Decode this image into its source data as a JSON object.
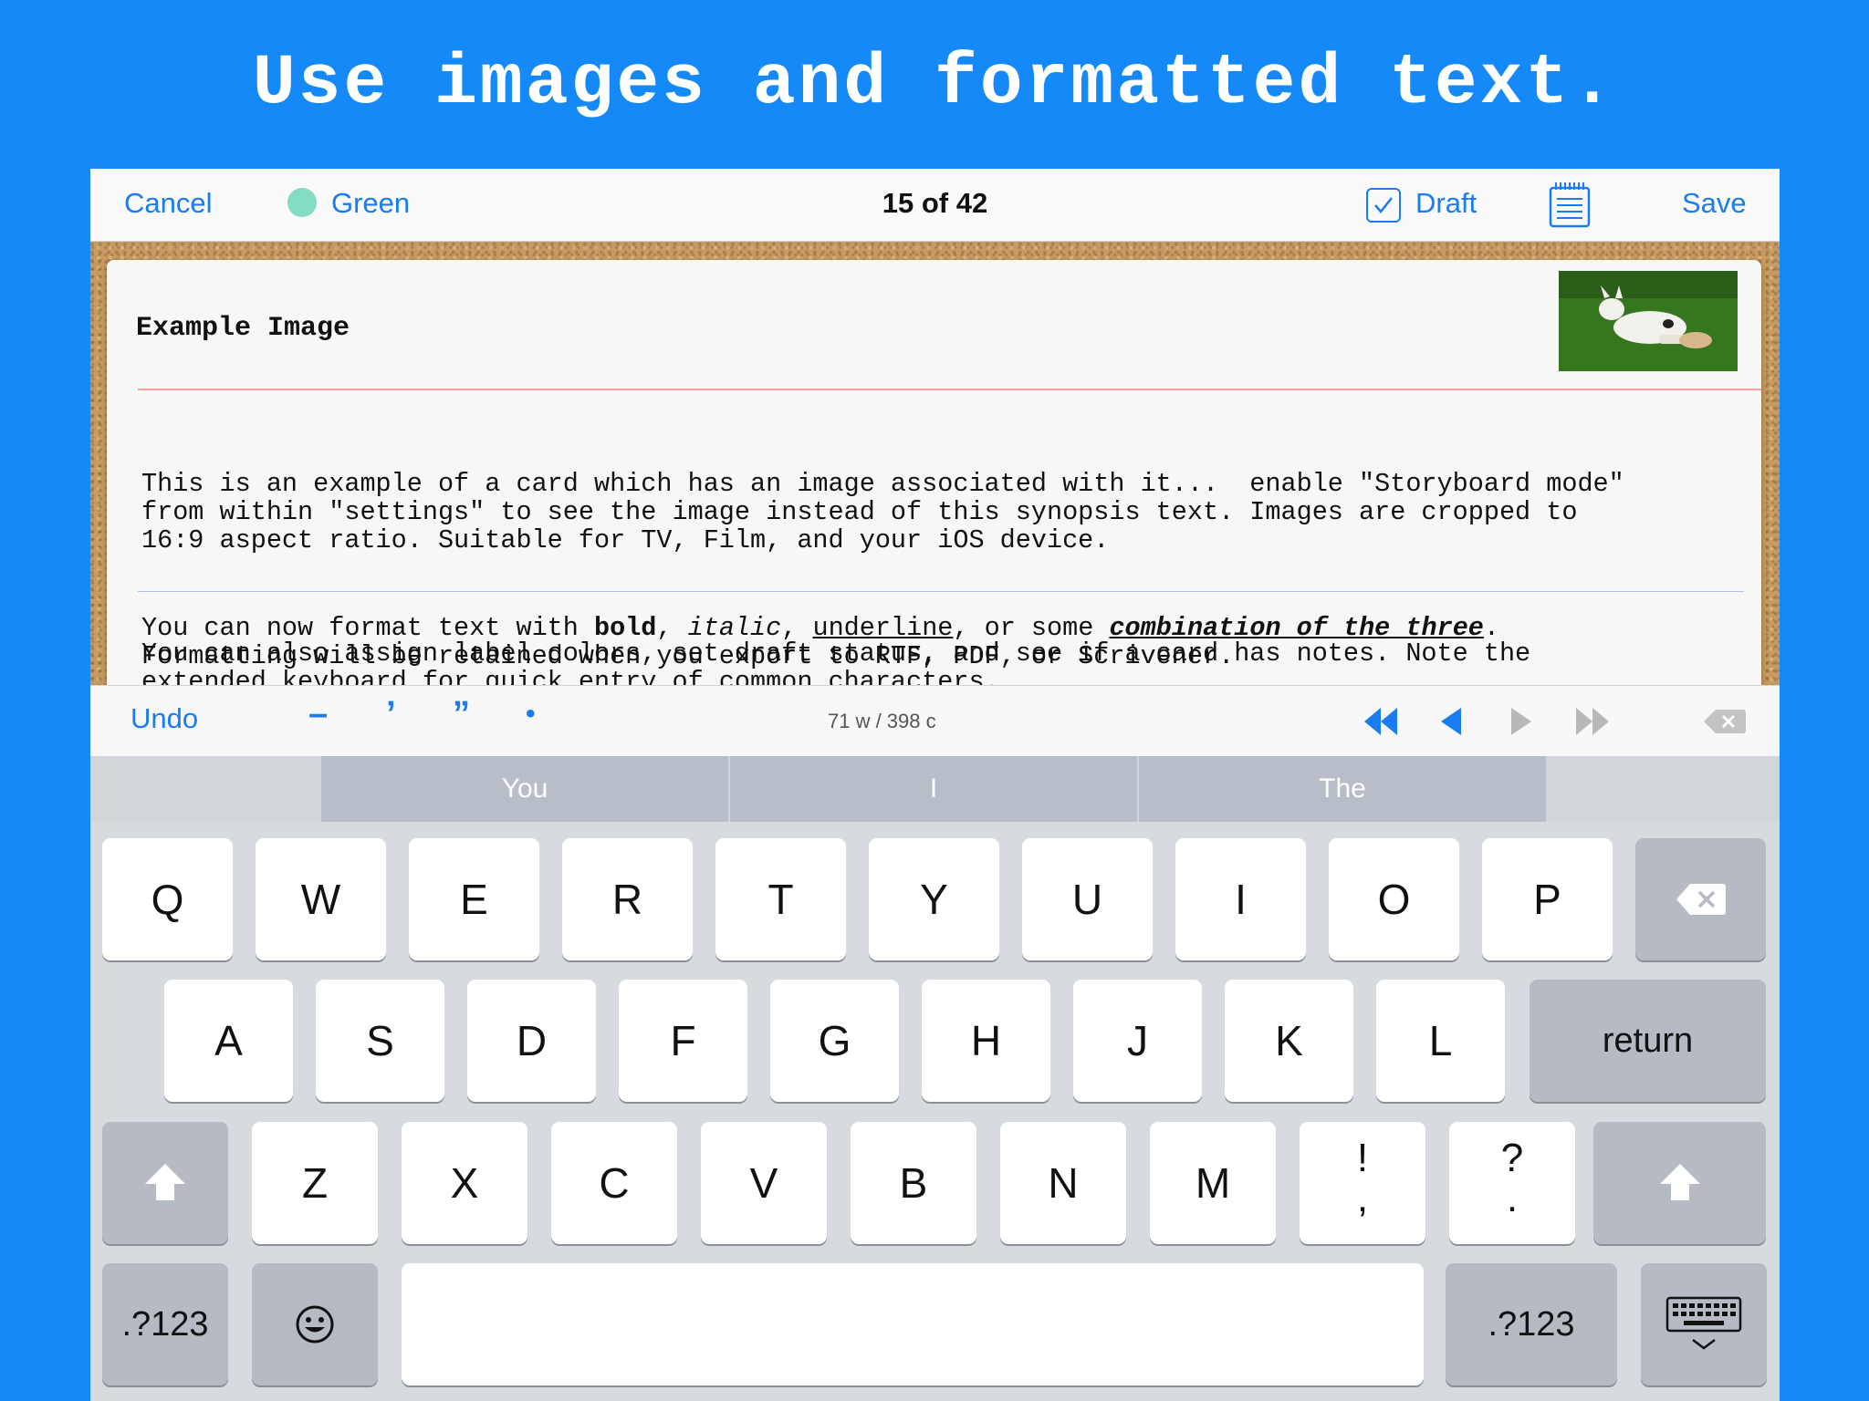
{
  "headline": "Use images and formatted text.",
  "navbar": {
    "cancel": "Cancel",
    "label_color_name": "Green",
    "label_color": "#84dcc2",
    "position": "15 of 42",
    "draft": "Draft",
    "save": "Save",
    "draft_checked": true
  },
  "card": {
    "title": "Example Image",
    "para1": "This is an example of a card which has an image associated with it...  enable \"Storyboard mode\"\nfrom within \"settings\" to see the image instead of this synopsis text. Images are cropped to\n16:9 aspect ratio. Suitable for TV, Film, and your iOS device.",
    "para2": "You can also assign label colors, set draft status, and see if a card has notes. Note the\nextended keyboard for quick entry of common characters.",
    "para3_a": "You can now format text with ",
    "para3_bold": "bold",
    "para3_sep1": ", ",
    "para3_italic": "italic",
    "para3_sep2": ", ",
    "para3_underline": "underline",
    "para3_sep3": ", or some ",
    "para3_combo": "combination of the three",
    "para3_end": ".",
    "para3_line2": "Formatting will be retained when you export to RTF, PDF, or Scrivener."
  },
  "accessory": {
    "undo": "Undo",
    "chars": [
      "–",
      "’",
      "”",
      "•"
    ],
    "count": "71 w / 398 c"
  },
  "suggestions": [
    "You",
    "I",
    "The"
  ],
  "keyboard": {
    "row1": [
      "Q",
      "W",
      "E",
      "R",
      "T",
      "Y",
      "U",
      "I",
      "O",
      "P"
    ],
    "row2": [
      "A",
      "S",
      "D",
      "F",
      "G",
      "H",
      "J",
      "K",
      "L"
    ],
    "return": "return",
    "row3": [
      "Z",
      "X",
      "C",
      "V",
      "B",
      "N",
      "M"
    ],
    "excl_top": "!",
    "excl_bottom": ",",
    "quest_top": "?",
    "quest_bottom": ".",
    "numbers": ".?123"
  }
}
